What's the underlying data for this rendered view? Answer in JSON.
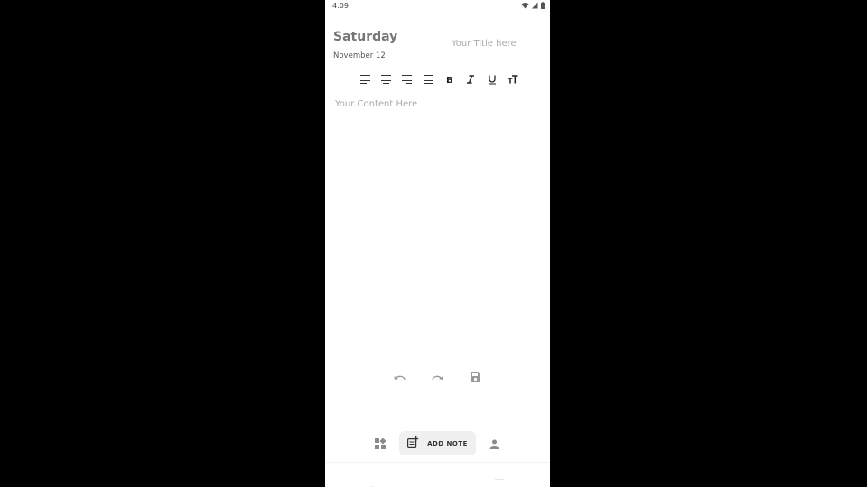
{
  "status_bar": {
    "time": "4:09",
    "icons": [
      "wifi-icon",
      "signal-icon",
      "battery-icon"
    ]
  },
  "header": {
    "day": "Saturday",
    "date": "November 12",
    "title_placeholder": "Your Title here"
  },
  "format_toolbar": {
    "items": [
      {
        "name": "align-left-icon"
      },
      {
        "name": "align-center-icon"
      },
      {
        "name": "align-right-icon"
      },
      {
        "name": "align-justify-icon"
      },
      {
        "name": "bold-icon",
        "glyph": "B"
      },
      {
        "name": "italic-icon",
        "glyph": "I"
      },
      {
        "name": "underline-icon",
        "glyph": "U"
      },
      {
        "name": "text-size-icon",
        "glyph": "тT"
      }
    ]
  },
  "editor": {
    "content_placeholder": "Your Content Here"
  },
  "actions": {
    "items": [
      "undo-icon",
      "redo-icon",
      "save-icon"
    ]
  },
  "bottom_nav": {
    "add_note_label": "ADD NOTE",
    "items": [
      "dashboard-icon",
      "add-note-icon",
      "person-icon"
    ]
  },
  "colors": {
    "background": "#000000",
    "screen": "#ffffff",
    "text_dark": "#333333",
    "text_muted": "#757575",
    "placeholder": "#aaaaaa",
    "pill": "#f0f0f0"
  }
}
